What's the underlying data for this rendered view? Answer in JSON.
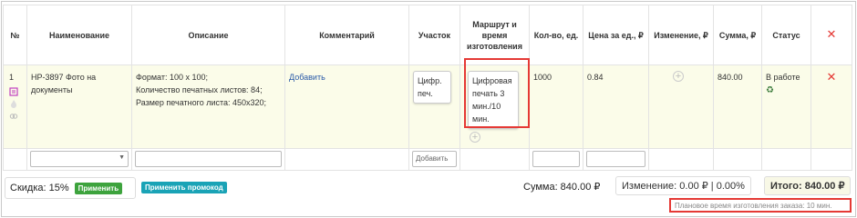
{
  "columns": [
    "№",
    "Наименование",
    "Описание",
    "Комментарий",
    "Участок",
    "Маршрут и время изготовления",
    "Кол-во, ед.",
    "Цена за ед., ₽",
    "Изменение, ₽",
    "Сумма, ₽",
    "Статус"
  ],
  "row": {
    "num": "1",
    "name": "HP-3897 Фото на документы",
    "desc": [
      "Формат: 100 x 100;",
      "Количество печатных листов: 84;",
      "Размер печатного листа: 450x320;"
    ],
    "comment_link": "Добавить",
    "section": "Цифр. печ.",
    "route": "Цифровая печать 3 мин./10 мин.",
    "qty": "1000",
    "price": "0.84",
    "sum": "840.00",
    "status": "В работе"
  },
  "inputs": {
    "add_button": "Добавить"
  },
  "footer": {
    "discount_label": "Скидка: 15%",
    "apply_button": "Применить",
    "promo_button": "Применить промокод",
    "sum_label": "Сумма: 840.00 ₽",
    "change_label": "Изменение: 0.00 ₽ | 0.00%",
    "total_label": "Итого: 840.00 ₽",
    "plan_time": "Плановое время изготовления заказа: 10 мин."
  },
  "colors": {
    "accent_red": "#e53935",
    "green": "#3da33d",
    "teal": "#1aa3b6",
    "row_bg": "#fbfce9"
  }
}
